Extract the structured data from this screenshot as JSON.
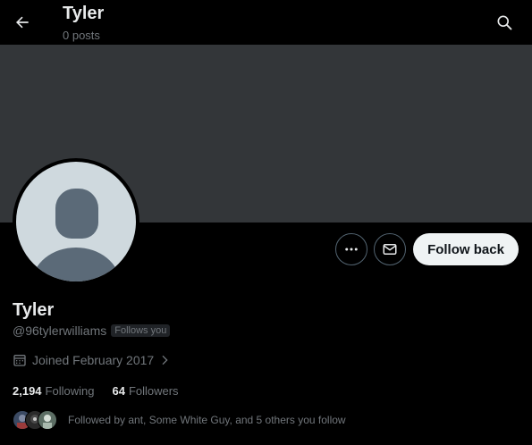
{
  "header": {
    "title": "Tyler",
    "subtitle": "0 posts",
    "back_icon": "arrow-left-icon",
    "search_icon": "search-icon"
  },
  "profile": {
    "name": "Tyler",
    "handle": "@96tylerwilliams",
    "follows_you_badge": "Follows you",
    "joined": "Joined February 2017",
    "following_count": "2,194",
    "following_label": "Following",
    "followers_count": "64",
    "followers_label": "Followers",
    "followed_by": "Followed by ant, Some White Guy, and 5 others you follow"
  },
  "actions": {
    "more_icon": "more-horizontal-icon",
    "message_icon": "envelope-icon",
    "follow_back_label": "Follow back"
  },
  "colors": {
    "background": "#000000",
    "banner": "#333639",
    "secondary_text": "#71767b",
    "button_bg": "#eff3f4"
  }
}
